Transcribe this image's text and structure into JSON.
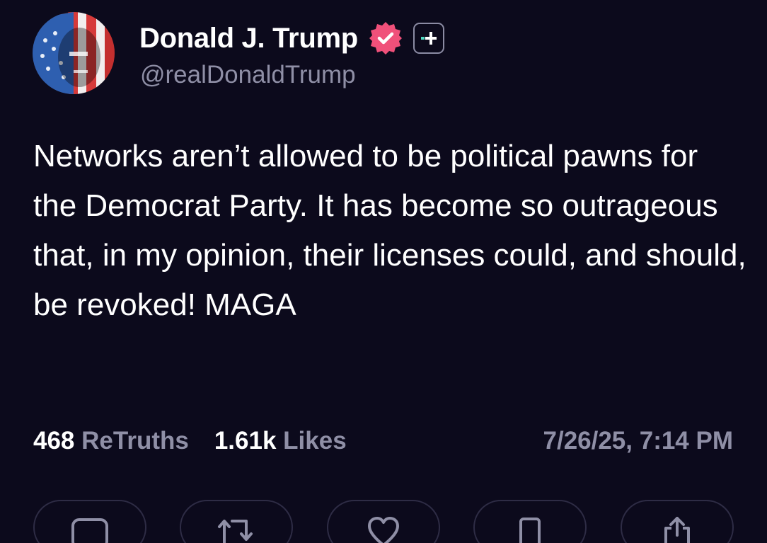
{
  "profile": {
    "display_name": "Donald J. Trump",
    "handle": "@realDonaldTrump",
    "verified_badge_color": "#f0507a",
    "avatar_icon": "avatar-flag-portrait"
  },
  "post": {
    "text": "Networks aren’t allowed to be political pawns for the Democrat Party. It has become so outrageous that, in my opinion, their licenses could, and should, be revoked! MAGA"
  },
  "stats": {
    "retruths_count": "468",
    "retruths_label": "ReTruths",
    "likes_count": "1.61k",
    "likes_label": "Likes",
    "timestamp": "7/26/25, 7:14 PM"
  },
  "actions": [
    {
      "icon": "reply-icon"
    },
    {
      "icon": "retruth-icon"
    },
    {
      "icon": "heart-icon"
    },
    {
      "icon": "bookmark-icon"
    },
    {
      "icon": "share-icon"
    }
  ],
  "colors": {
    "background": "#0c0a1c",
    "muted_text": "#8f8fa6",
    "button_border": "#2e2c45",
    "plus_accent": "#4fd8c0"
  }
}
